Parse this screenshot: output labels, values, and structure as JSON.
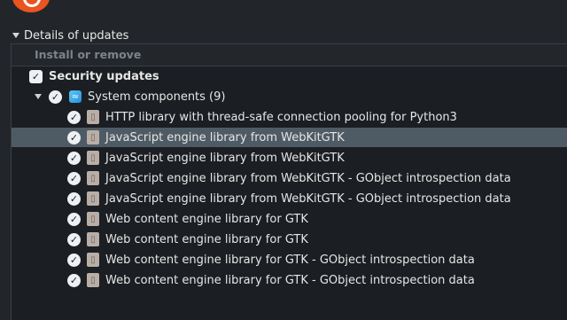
{
  "details_label": "Details of updates",
  "column_header": "Install or remove",
  "section": {
    "label": "Security updates"
  },
  "group": {
    "label": "System components (9)"
  },
  "items": [
    {
      "label": "HTTP library with thread-safe connection pooling for Python3"
    },
    {
      "label": "JavaScript engine library from WebKitGTK"
    },
    {
      "label": "JavaScript engine library from WebKitGTK"
    },
    {
      "label": "JavaScript engine library from WebKitGTK - GObject introspection data"
    },
    {
      "label": "JavaScript engine library from WebKitGTK - GObject introspection data"
    },
    {
      "label": "Web content engine library for GTK"
    },
    {
      "label": "Web content engine library for GTK"
    },
    {
      "label": "Web content engine library for GTK - GObject introspection data"
    },
    {
      "label": "Web content engine library for GTK - GObject introspection data"
    }
  ],
  "selected_index": 1,
  "icons": {
    "check": "check-icon",
    "package": "package-icon",
    "category": "system-components-icon"
  },
  "colors": {
    "accent": "#e95420",
    "selection": "#4f5b64"
  }
}
